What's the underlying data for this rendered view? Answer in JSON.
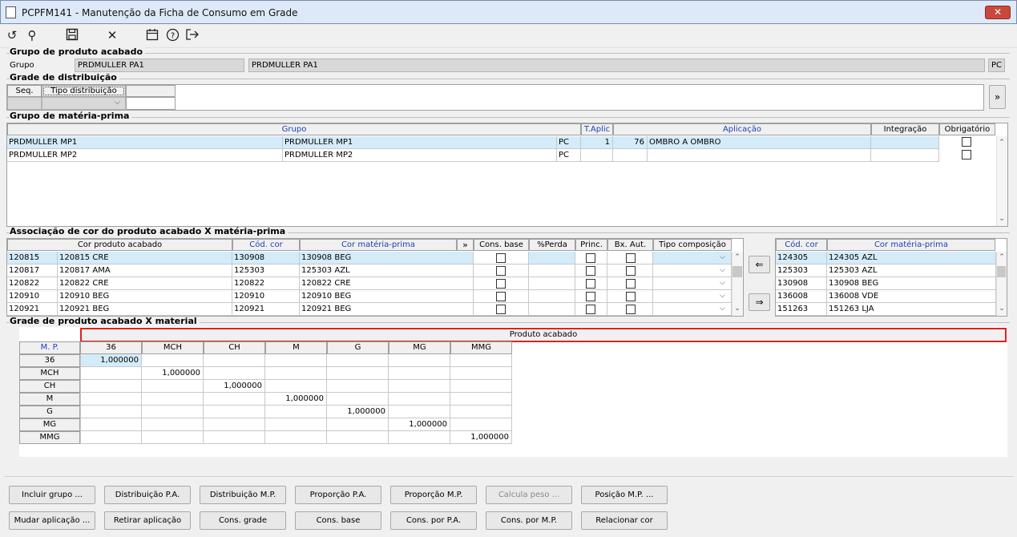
{
  "window": {
    "title": "PCPFM141 - Manutenção da Ficha de Consumo em Grade",
    "close_label": "✕"
  },
  "sections": {
    "grupo_pa": "Grupo de produto acabado",
    "grade_dist": "Grade de distribuição",
    "grupo_mp": "Grupo de matéria-prima",
    "assoc": "Associação de cor do produto acabado X matéria-prima",
    "grade_pa": "Grade de produto acabado X material"
  },
  "grupo_pa": {
    "label": "Grupo",
    "code": "PRDMULLER PA1",
    "desc": "PRDMULLER PA1",
    "unit": "PC"
  },
  "grade_dist": {
    "seq_header": "Seq.",
    "tipo_header": "Tipo distribuição",
    "more_btn": "»"
  },
  "grupo_mp": {
    "headers": [
      "Grupo",
      "T.Aplic",
      "Aplicação",
      "Integração",
      "Obrigatório"
    ],
    "rows": [
      {
        "grupo": "PRDMULLER MP1",
        "desc": "PRDMULLER MP1",
        "un": "PC",
        "taplic": "1",
        "apl_code": "76",
        "aplicacao": "OMBRO A OMBRO"
      },
      {
        "grupo": "PRDMULLER MP2",
        "desc": "PRDMULLER MP2",
        "un": "PC",
        "taplic": "",
        "apl_code": "",
        "aplicacao": ""
      }
    ]
  },
  "assoc": {
    "headers": [
      "Cor produto acabado",
      "Cód. cor",
      "Cor matéria-prima",
      "»",
      "Cons. base",
      "%Perda",
      "Princ.",
      "Bx. Aut.",
      "Tipo composição"
    ],
    "rows": [
      [
        "120815",
        "120815 CRE",
        "130908",
        "130908 BEG"
      ],
      [
        "120817",
        "120817 AMA",
        "125303",
        "125303 AZL"
      ],
      [
        "120822",
        "120822 CRE",
        "120822",
        "120822 CRE"
      ],
      [
        "120910",
        "120910 BEG",
        "120910",
        "120910 BEG"
      ],
      [
        "120921",
        "120921 BEG",
        "120921",
        "120921 BEG"
      ]
    ],
    "right_headers": [
      "Cód. cor",
      "Cor matéria-prima"
    ],
    "right_rows": [
      [
        "124305",
        "124305 AZL"
      ],
      [
        "125303",
        "125303 AZL"
      ],
      [
        "130908",
        "130908 BEG"
      ],
      [
        "136008",
        "136008 VDE"
      ],
      [
        "151263",
        "151263 LJA"
      ]
    ]
  },
  "grade_pa": {
    "banner": "Produto acabado",
    "corner": "M. P.",
    "cols": [
      "36",
      "MCH",
      "CH",
      "M",
      "G",
      "MG",
      "MMG"
    ],
    "rows": [
      "36",
      "MCH",
      "CH",
      "M",
      "G",
      "MG",
      "MMG"
    ],
    "value": "1,000000"
  },
  "buttons": {
    "row1": [
      "Incluir grupo ...",
      "Distribuição P.A.",
      "Distribuição M.P.",
      "Proporção P.A.",
      "Proporção M.P.",
      "Calcula peso ...",
      "Posição M.P. ..."
    ],
    "row2": [
      "Mudar aplicação ...",
      "Retirar aplicação",
      "Cons. grade",
      "Cons. base",
      "Cons. por P.A.",
      "Cons. por M.P.",
      "Relacionar cor"
    ]
  },
  "colors": {
    "accent_blue": "#1b3fb7",
    "selection": "#d4ecf9",
    "banner_border": "#e02020"
  }
}
